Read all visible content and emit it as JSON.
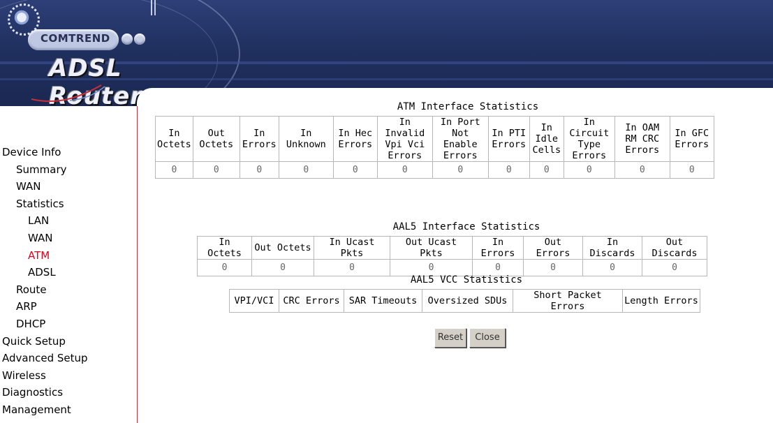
{
  "header": {
    "brand": "COMTREND",
    "product": "ADSL Router"
  },
  "sidebar": {
    "items": [
      {
        "label": "Device Info",
        "level": 0
      },
      {
        "label": "Summary",
        "level": 1
      },
      {
        "label": "WAN",
        "level": 1
      },
      {
        "label": "Statistics",
        "level": 1
      },
      {
        "label": "LAN",
        "level": 2
      },
      {
        "label": "WAN",
        "level": 2
      },
      {
        "label": "ATM",
        "level": 2,
        "active": true
      },
      {
        "label": "ADSL",
        "level": 2
      },
      {
        "label": "Route",
        "level": 1
      },
      {
        "label": "ARP",
        "level": 1
      },
      {
        "label": "DHCP",
        "level": 1
      },
      {
        "label": "Quick Setup",
        "level": 0
      },
      {
        "label": "Advanced Setup",
        "level": 0
      },
      {
        "label": "Wireless",
        "level": 0
      },
      {
        "label": "Diagnostics",
        "level": 0
      },
      {
        "label": "Management",
        "level": 0
      }
    ],
    "active_color": "#e1001a"
  },
  "atm_table": {
    "title": "ATM Interface Statistics",
    "headers": [
      [
        "In",
        "Octets"
      ],
      [
        "Out",
        "Octets"
      ],
      [
        "In",
        "Errors"
      ],
      [
        "In",
        "Unknown"
      ],
      [
        "In Hec",
        "Errors"
      ],
      [
        "In Invalid",
        "Vpi Vci",
        "Errors"
      ],
      [
        "In Port",
        "Not Enable",
        "Errors"
      ],
      [
        "In PTI",
        "Errors"
      ],
      [
        "In",
        "Idle",
        "Cells"
      ],
      [
        "In Circuit",
        "Type",
        "Errors"
      ],
      [
        "In OAM",
        "RM CRC",
        "Errors"
      ],
      [
        "In GFC",
        "Errors"
      ]
    ],
    "values": [
      "0",
      "0",
      "0",
      "0",
      "0",
      "0",
      "0",
      "0",
      "0",
      "0",
      "0",
      "0"
    ]
  },
  "aal5_table": {
    "title": "AAL5 Interface Statistics",
    "headers": [
      "In Octets",
      "Out Octets",
      "In Ucast Pkts",
      "Out Ucast Pkts",
      "In Errors",
      "Out Errors",
      "In Discards",
      "Out Discards"
    ],
    "values": [
      "0",
      "0",
      "0",
      "0",
      "0",
      "0",
      "0",
      "0"
    ]
  },
  "vcc_table": {
    "title": "AAL5 VCC Statistics",
    "headers": [
      "VPI/VCI",
      "CRC Errors",
      "SAR Timeouts",
      "Oversized SDUs",
      "Short Packet Errors",
      "Length Errors"
    ]
  },
  "buttons": {
    "reset": "Reset",
    "close": "Close"
  }
}
